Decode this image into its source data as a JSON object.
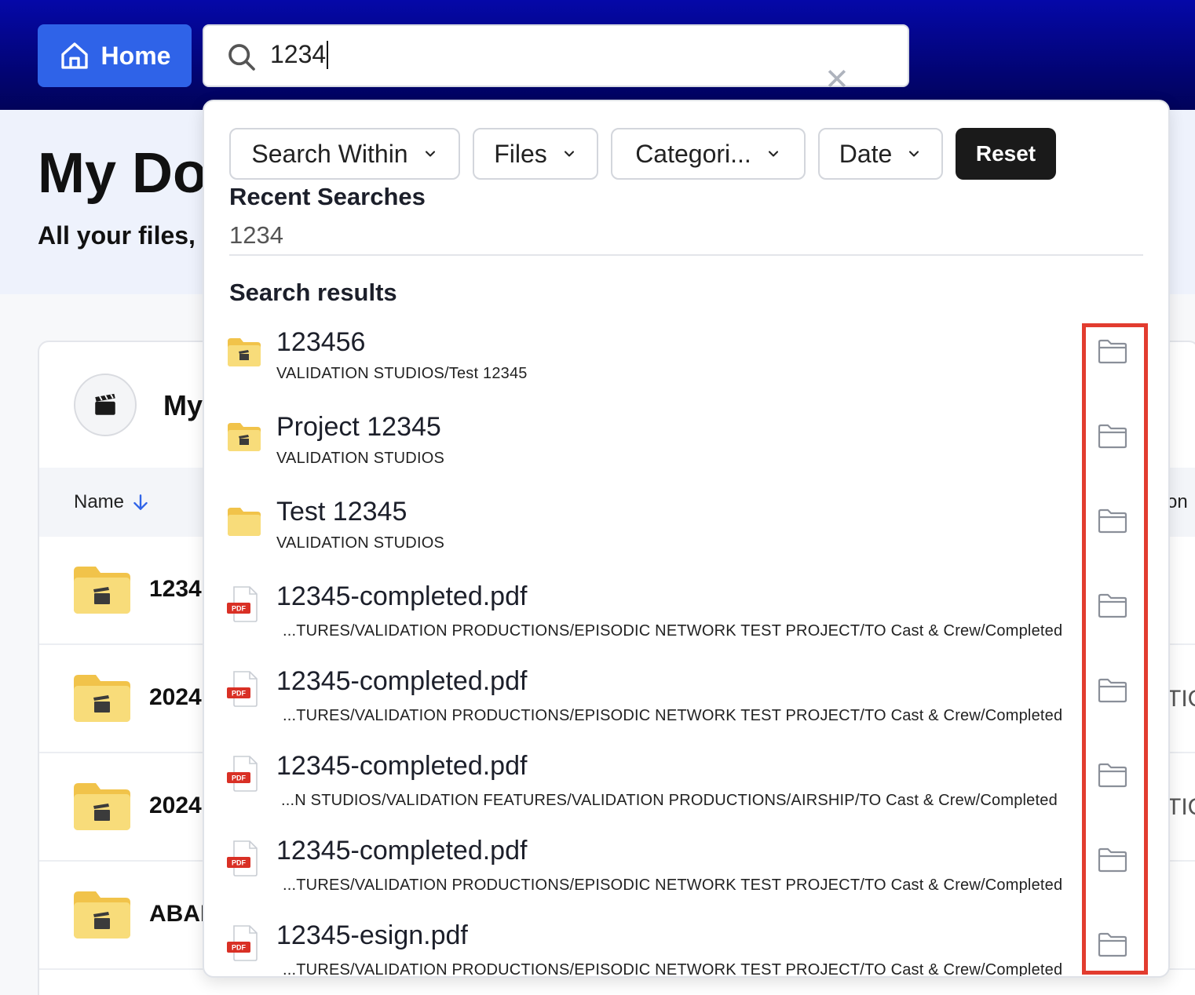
{
  "topbar": {
    "home_label": "Home",
    "search_value": "1234"
  },
  "hero": {
    "title": "My Do",
    "subtitle": "All your files, a"
  },
  "project": {
    "name": "My"
  },
  "table": {
    "col_name": "Name",
    "col_right": "on",
    "rows": [
      {
        "name": "1234",
        "right": ""
      },
      {
        "name": "2024",
        "right": "TIC"
      },
      {
        "name": "2024",
        "right": "TIC"
      },
      {
        "name": "ABAE",
        "right": ""
      }
    ]
  },
  "dropdown": {
    "filters": [
      "Search Within",
      "Files",
      "Categori...",
      "Date"
    ],
    "reset_label": "Reset",
    "recent_title": "Recent Searches",
    "recent_items": [
      "1234"
    ],
    "results_title": "Search results",
    "results": [
      {
        "type": "project-folder",
        "title": "123456",
        "path": "VALIDATION STUDIOS/Test 12345"
      },
      {
        "type": "project-folder",
        "title": "Project 12345",
        "path": "VALIDATION STUDIOS"
      },
      {
        "type": "folder",
        "title": "Test 12345",
        "path": "VALIDATION STUDIOS"
      },
      {
        "type": "pdf",
        "title": "12345-completed.pdf",
        "path": "...TURES/VALIDATION PRODUCTIONS/EPISODIC NETWORK TEST PROJECT/TO Cast & Crew/Completed"
      },
      {
        "type": "pdf",
        "title": "12345-completed.pdf",
        "path": "...TURES/VALIDATION PRODUCTIONS/EPISODIC NETWORK TEST PROJECT/TO Cast & Crew/Completed"
      },
      {
        "type": "pdf",
        "title": "12345-completed.pdf",
        "path": "...N STUDIOS/VALIDATION FEATURES/VALIDATION PRODUCTIONS/AIRSHIP/TO Cast & Crew/Completed"
      },
      {
        "type": "pdf",
        "title": "12345-completed.pdf",
        "path": "...TURES/VALIDATION PRODUCTIONS/EPISODIC NETWORK TEST PROJECT/TO Cast & Crew/Completed"
      },
      {
        "type": "pdf",
        "title": "12345-esign.pdf",
        "path": "...TURES/VALIDATION PRODUCTIONS/EPISODIC NETWORK TEST PROJECT/TO Cast & Crew/Completed"
      }
    ],
    "pdf_badge": "PDF"
  },
  "colors": {
    "topbar": "#020470",
    "home_button": "#2f63e8",
    "highlight": "#e23c2f",
    "folder": "#f6d26a"
  }
}
